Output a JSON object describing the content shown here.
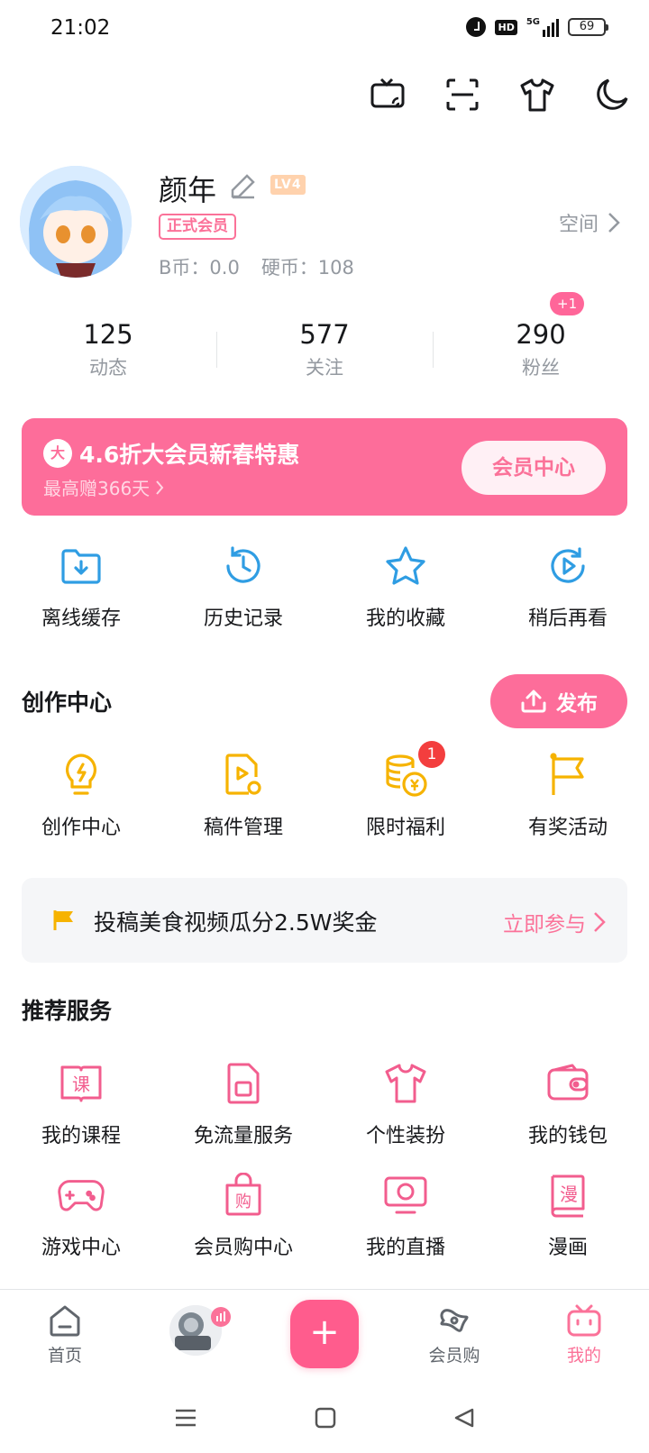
{
  "status_bar": {
    "time": "21:02",
    "hd": "HD",
    "network": "5G",
    "battery": "69"
  },
  "top_actions": [
    "cast-icon",
    "scan-icon",
    "skin-icon",
    "night-mode-icon"
  ],
  "profile": {
    "name": "颜年",
    "level": "LV4",
    "vip_tag": "正式会员",
    "bcoin": "B币：0.0",
    "coins": "硬币：108",
    "space_link": "空间"
  },
  "stats": [
    {
      "value": "125",
      "label": "动态"
    },
    {
      "value": "577",
      "label": "关注"
    },
    {
      "value": "290",
      "label": "粉丝"
    }
  ],
  "fans_badge": "+1",
  "vip_banner": {
    "icon_char": "大",
    "title": "4.6折大会员新春特惠",
    "subtitle": "最高赠366天",
    "button": "会员中心",
    "colors": {
      "bg": "#fd6d9a",
      "accent": "#fb7299"
    }
  },
  "quick_actions": [
    {
      "label": "离线缓存",
      "icon": "download-folder-icon"
    },
    {
      "label": "历史记录",
      "icon": "history-icon"
    },
    {
      "label": "我的收藏",
      "icon": "star-icon"
    },
    {
      "label": "稍后再看",
      "icon": "watch-later-icon"
    }
  ],
  "creation": {
    "title": "创作中心",
    "publish_button": "发布",
    "items": [
      {
        "label": "创作中心",
        "icon": "lightbulb-icon"
      },
      {
        "label": "稿件管理",
        "icon": "manuscript-icon"
      },
      {
        "label": "限时福利",
        "icon": "coins-icon",
        "badge": "1"
      },
      {
        "label": "有奖活动",
        "icon": "flag-icon"
      }
    ]
  },
  "promo": {
    "text": "投稿美食视频瓜分2.5W奖金",
    "link": "立即参与"
  },
  "services": {
    "title": "推荐服务",
    "row1": [
      {
        "label": "我的课程",
        "icon": "course-icon"
      },
      {
        "label": "免流量服务",
        "icon": "sim-card-icon"
      },
      {
        "label": "个性装扮",
        "icon": "tshirt-icon"
      },
      {
        "label": "我的钱包",
        "icon": "wallet-icon"
      }
    ],
    "row2": [
      {
        "label": "游戏中心",
        "icon": "gamepad-icon"
      },
      {
        "label": "会员购中心",
        "icon": "shopping-bag-icon"
      },
      {
        "label": "我的直播",
        "icon": "live-tv-icon"
      },
      {
        "label": "漫画",
        "icon": "comic-book-icon"
      }
    ],
    "icon_char_course": "课",
    "icon_char_shop": "购",
    "icon_char_comic": "漫"
  },
  "bottom_nav": [
    {
      "label": "首页",
      "icon": "home-icon"
    },
    {
      "label": "",
      "icon": "dynamic-thumb-icon"
    },
    {
      "label": "",
      "icon": "plus-icon"
    },
    {
      "label": "会员购",
      "icon": "mall-icon"
    },
    {
      "label": "我的",
      "icon": "tv-mine-icon",
      "active": true
    }
  ],
  "center_plus": "+"
}
